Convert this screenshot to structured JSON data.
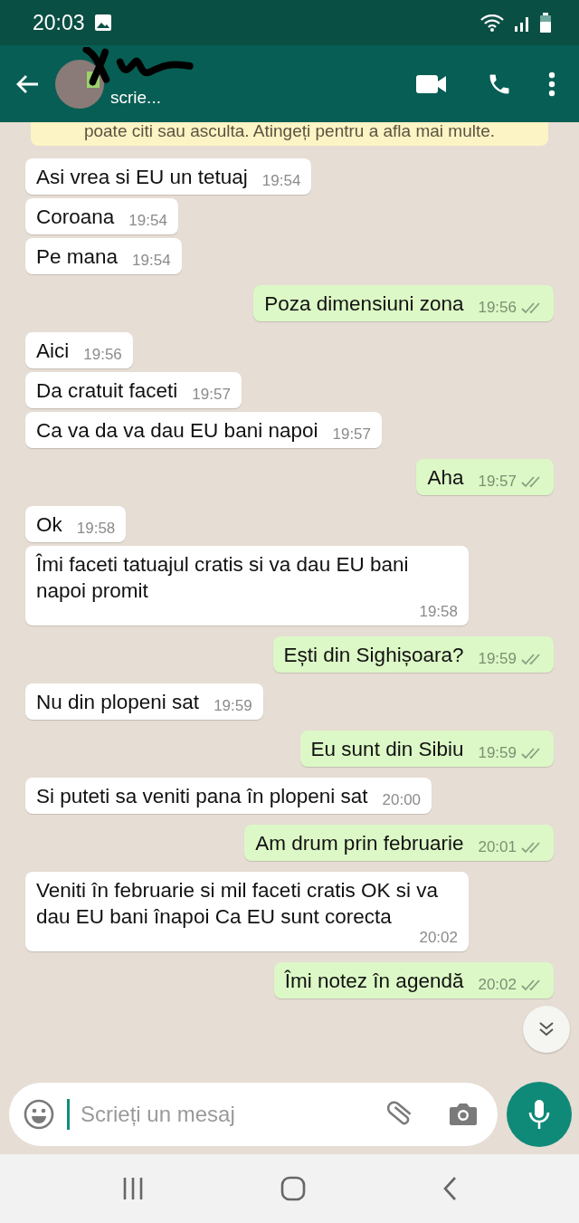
{
  "status_bar": {
    "time": "20:03"
  },
  "header": {
    "status": "scrie..."
  },
  "notice": {
    "text": "poate citi sau asculta. Atingeți pentru a afla mai multe."
  },
  "messages": [
    {
      "kind": "in",
      "text": "Asi vrea si EU un tetuaj",
      "time": "19:54"
    },
    {
      "kind": "in",
      "text": "Coroana",
      "time": "19:54"
    },
    {
      "kind": "in",
      "text": "Pe mana",
      "time": "19:54"
    },
    {
      "kind": "out",
      "text": "Poza dimensiuni zona",
      "time": "19:56",
      "read": false
    },
    {
      "kind": "in",
      "text": "Aici",
      "time": "19:56"
    },
    {
      "kind": "in",
      "text": "Da cratuit faceti",
      "time": "19:57"
    },
    {
      "kind": "in",
      "text": "Ca va da va dau EU bani napoi",
      "time": "19:57"
    },
    {
      "kind": "out",
      "text": "Aha",
      "time": "19:57",
      "read": false
    },
    {
      "kind": "in",
      "text": "Ok",
      "time": "19:58"
    },
    {
      "kind": "in",
      "text": "Îmi faceti tatuajul cratis si va dau EU bani napoi promit",
      "time": "19:58"
    },
    {
      "kind": "out",
      "text": "Ești din Sighișoara?",
      "time": "19:59",
      "read": false
    },
    {
      "kind": "in",
      "text": "Nu din plopeni sat",
      "time": "19:59"
    },
    {
      "kind": "out",
      "text": "Eu sunt din Sibiu",
      "time": "19:59",
      "read": false
    },
    {
      "kind": "in",
      "text": "Si puteti sa veniti pana în plopeni sat",
      "time": "20:00"
    },
    {
      "kind": "out",
      "text": "Am drum prin februarie",
      "time": "20:01",
      "read": false
    },
    {
      "kind": "in",
      "text": "Veniti în februarie si mil faceti cratis OK si va dau EU bani înapoi Ca EU sunt corecta",
      "time": "20:02"
    },
    {
      "kind": "out",
      "text": "Îmi notez în agendă",
      "time": "20:02",
      "read": false
    }
  ],
  "composer": {
    "placeholder": "Scrieți un mesaj"
  }
}
